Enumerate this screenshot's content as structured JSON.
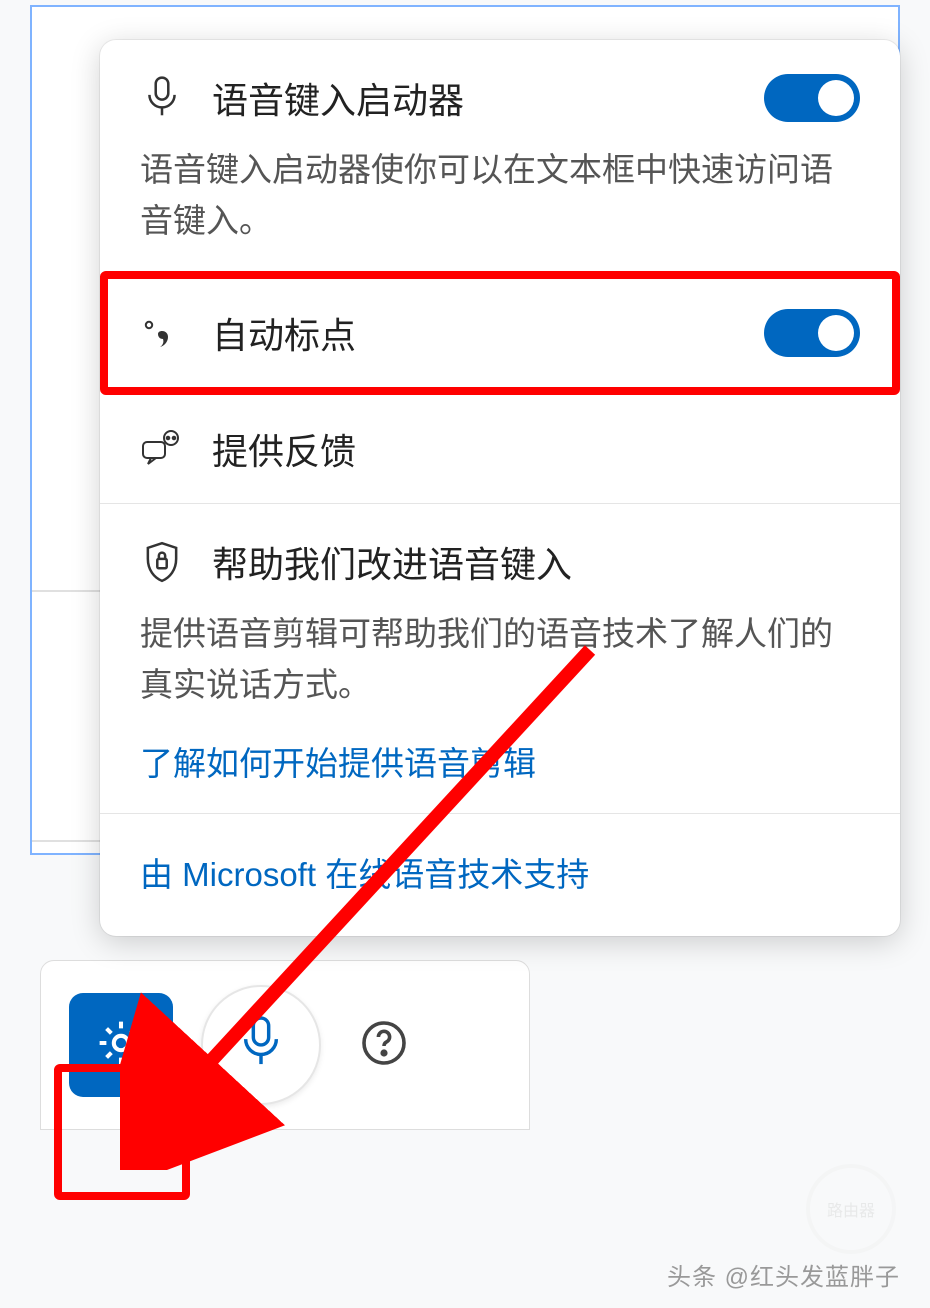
{
  "settings": {
    "voice_launcher": {
      "title": "语音键入启动器",
      "desc": "语音键入启动器使你可以在文本框中快速访问语音键入。",
      "on": true
    },
    "auto_punct": {
      "title": "自动标点",
      "on": true
    },
    "feedback": {
      "title": "提供反馈"
    },
    "improve": {
      "title": "帮助我们改进语音键入",
      "desc": "提供语音剪辑可帮助我们的语音技术了解人们的真实说话方式。",
      "link": "了解如何开始提供语音剪辑"
    },
    "footer": "由 Microsoft 在线语音技术支持"
  },
  "credit": "头条 @红头发蓝胖子",
  "wm": "路由器"
}
